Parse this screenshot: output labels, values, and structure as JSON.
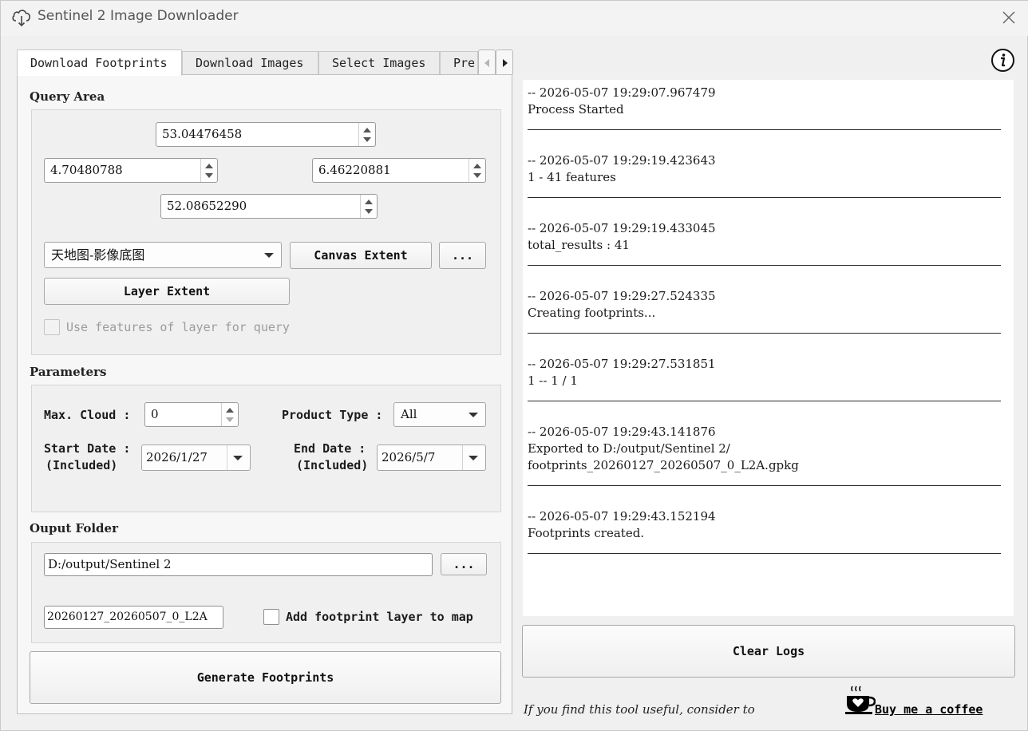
{
  "window": {
    "title": "Sentinel 2 Image Downloader"
  },
  "tabs": [
    {
      "label": "Download Footprints",
      "active": true
    },
    {
      "label": "Download Images",
      "active": false
    },
    {
      "label": "Select Images",
      "active": false
    },
    {
      "label": "Pre",
      "active": false
    }
  ],
  "query_area": {
    "title": "Query Area",
    "north": "53.04476458",
    "west": "4.70480788",
    "east": "6.46220881",
    "south": "52.08652290",
    "layer_combo": "天地图-影像底图",
    "canvas_extent_label": "Canvas Extent",
    "browse_label": "...",
    "layer_extent_label": "Layer Extent",
    "use_features_label": "Use features of layer for query"
  },
  "parameters": {
    "title": "Parameters",
    "max_cloud_label": "Max. Cloud :",
    "max_cloud_value": "0",
    "product_type_label": "Product Type :",
    "product_type_value": "All",
    "start_date_label_1": "Start Date :",
    "start_date_label_2": "(Included)",
    "start_date_value": "2026/1/27",
    "end_date_label_1": "End Date :",
    "end_date_label_2": "(Included)",
    "end_date_value": "2026/5/7"
  },
  "output": {
    "title": "Ouput Folder",
    "folder_value": "D:/output/Sentinel 2",
    "browse_label": "...",
    "file_name_value": "20260127_20260507_0_L2A",
    "add_layer_label": "Add footprint layer to map"
  },
  "generate_label": "Generate Footprints",
  "logs": [
    {
      "time": "-- 2026-05-07 19:29:07.967479",
      "lines": [
        "Process Started"
      ]
    },
    {
      "time": "-- 2026-05-07 19:29:19.423643",
      "lines": [
        "1 - 41 features"
      ]
    },
    {
      "time": "-- 2026-05-07 19:29:19.433045",
      "lines": [
        "total_results : 41"
      ]
    },
    {
      "time": "-- 2026-05-07 19:29:27.524335",
      "lines": [
        "Creating footprints..."
      ]
    },
    {
      "time": "-- 2026-05-07 19:29:27.531851",
      "lines": [
        "1 -- 1 / 1"
      ]
    },
    {
      "time": "-- 2026-05-07 19:29:43.141876",
      "lines": [
        "Exported to D:/output/Sentinel 2/",
        "footprints_20260127_20260507_0_L2A.gpkg"
      ]
    },
    {
      "time": "-- 2026-05-07 19:29:43.152194",
      "lines": [
        "Footprints created."
      ]
    }
  ],
  "clear_logs_label": "Clear Logs",
  "footer": {
    "text": "If you find this tool useful, consider to",
    "link": "Buy me a coffee"
  },
  "icons": {
    "app": "cloud-download-icon",
    "close": "close-icon",
    "info": "info-icon",
    "coffee": "coffee-cup-icon"
  }
}
